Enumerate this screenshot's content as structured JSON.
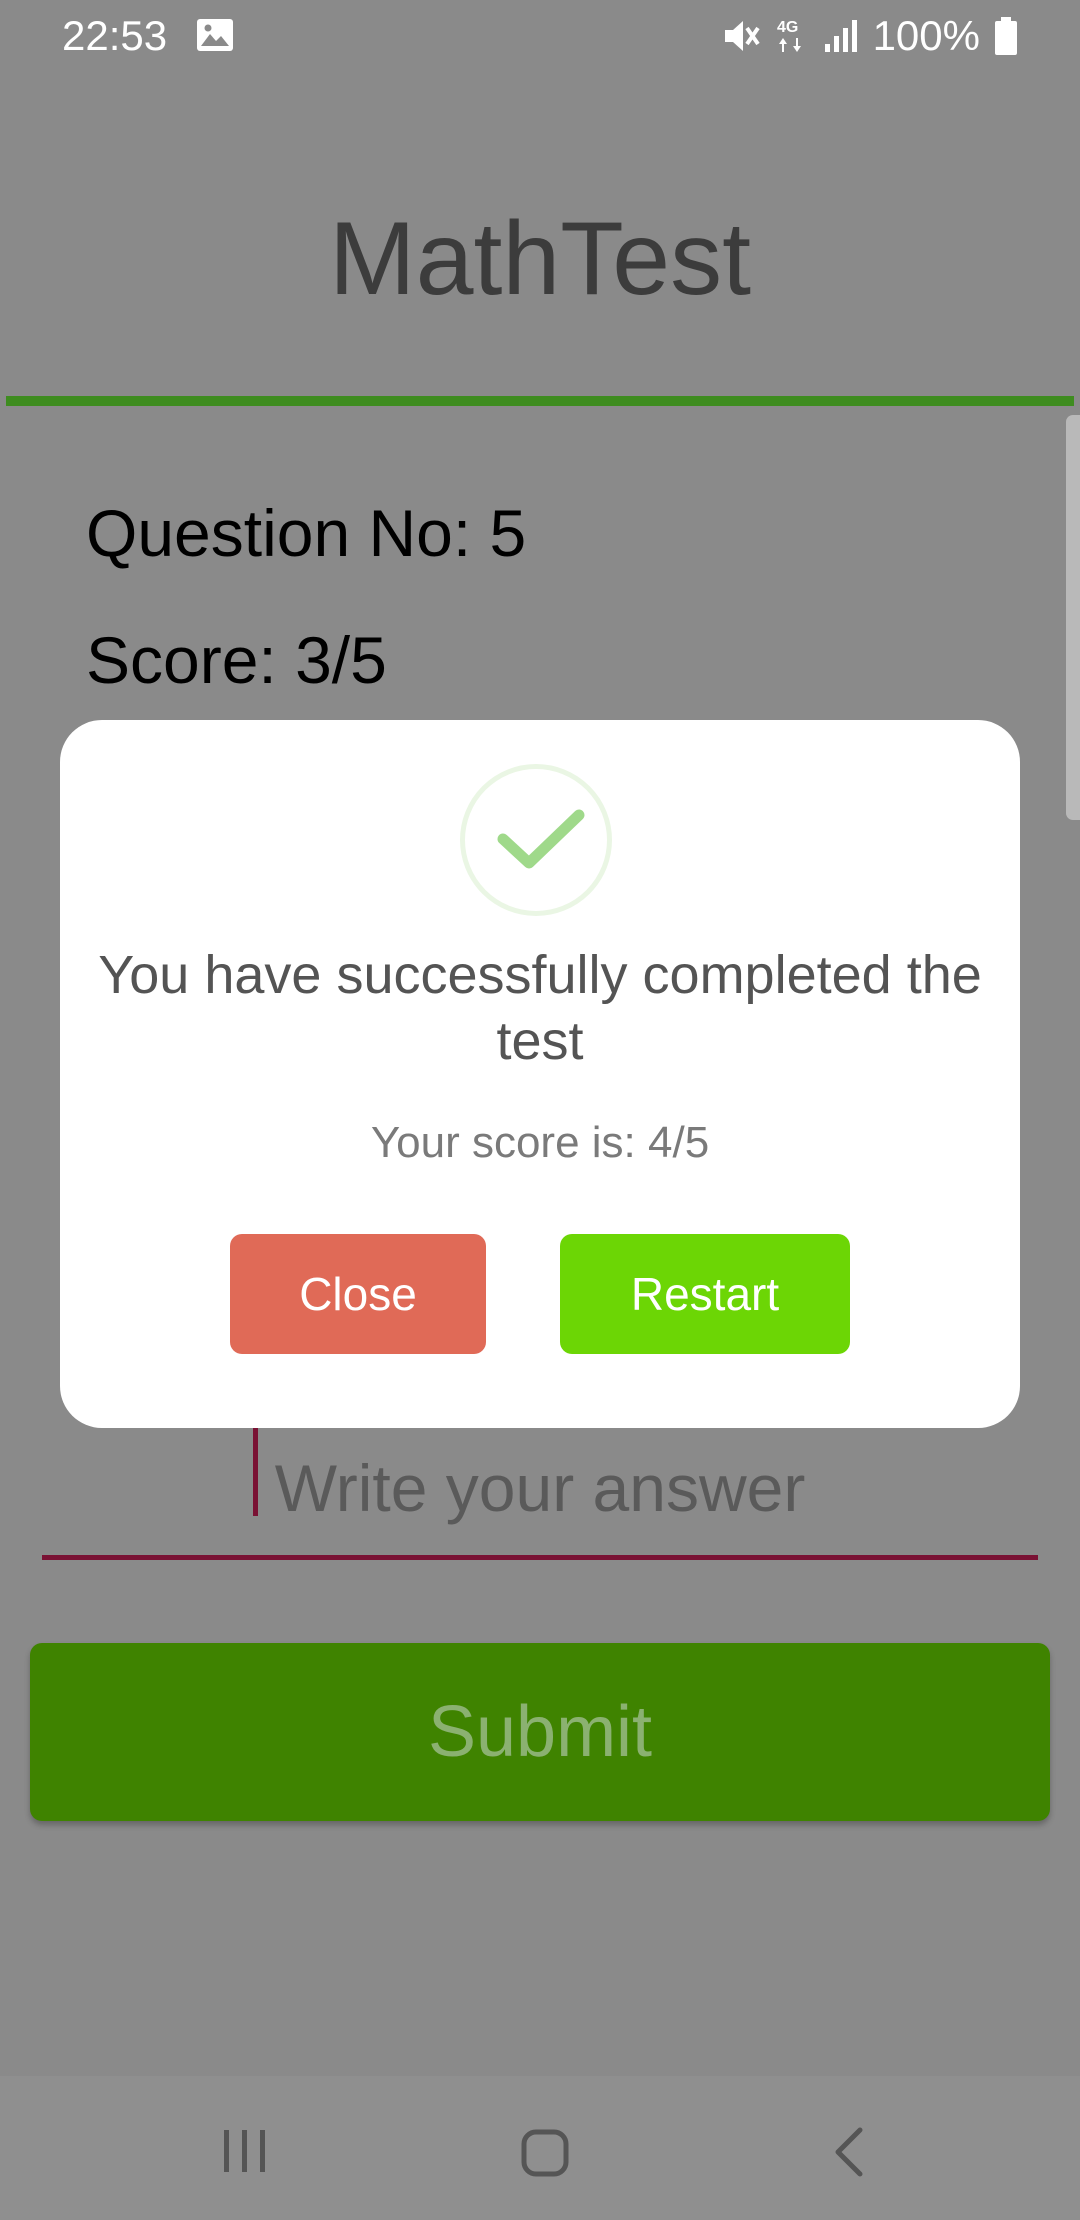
{
  "status_bar": {
    "time": "22:53",
    "battery": "100%",
    "network": "4G",
    "icons": [
      "gallery-icon",
      "mute-icon",
      "4g-icon",
      "signal-icon",
      "battery-icon"
    ]
  },
  "header": {
    "title": "MathTest",
    "divider_color": "#3e8c1f"
  },
  "info": {
    "question_no": "Question No: 5",
    "score": "Score: 3/5"
  },
  "answer": {
    "placeholder": "Write your answer",
    "value": ""
  },
  "submit": {
    "label": "Submit"
  },
  "dialog": {
    "icon": "check-icon",
    "title": "You have successfully completed the test",
    "score_text": "Your score is: 4/5",
    "close_label": "Close",
    "restart_label": "Restart"
  },
  "colors": {
    "overlay": "#8a8a8a",
    "submit": "#3f8300",
    "close": "#e06a57",
    "restart": "#6cd605",
    "accent_line": "#7a1234"
  },
  "nav_bar": {
    "icons": [
      "recents-icon",
      "home-icon",
      "back-icon"
    ]
  }
}
